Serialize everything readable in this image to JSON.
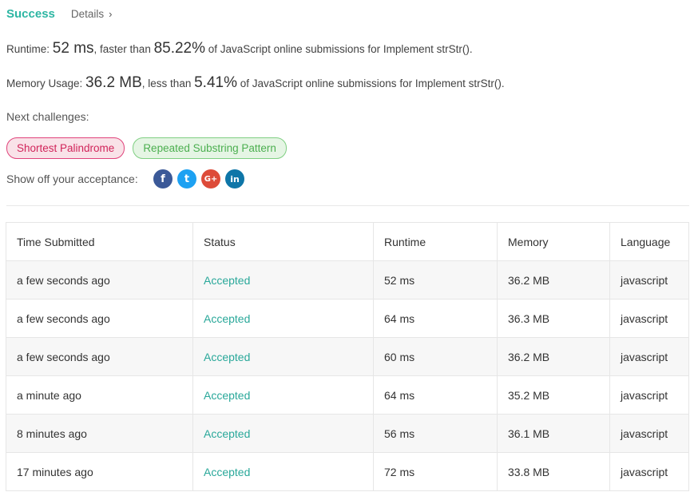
{
  "header": {
    "status": "Success",
    "details_label": "Details",
    "chevron": "›"
  },
  "runtime": {
    "label": "Runtime: ",
    "value": "52 ms",
    "middle": ", faster than ",
    "percent": "85.22%",
    "suffix": " of JavaScript online submissions for Implement strStr()."
  },
  "memory": {
    "label": "Memory Usage: ",
    "value": "36.2 MB",
    "middle": ", less than ",
    "percent": "5.41%",
    "suffix": " of JavaScript online submissions for Implement strStr()."
  },
  "next_challenges": {
    "label": "Next challenges:",
    "items": [
      {
        "label": "Shortest Palindrome",
        "difficulty": "hard",
        "color": "#d1245a"
      },
      {
        "label": "Repeated Substring Pattern",
        "difficulty": "easy",
        "color": "#4caf50"
      }
    ]
  },
  "share": {
    "label": "Show off your acceptance:",
    "icons": [
      {
        "name": "facebook-icon",
        "glyph": "f",
        "color": "#3b5998"
      },
      {
        "name": "twitter-icon",
        "glyph": "t",
        "color": "#1da1f2"
      },
      {
        "name": "google-plus-icon",
        "glyph": "G+",
        "color": "#dd4b39"
      },
      {
        "name": "linkedin-icon",
        "glyph": "in",
        "color": "#0e76a8"
      }
    ]
  },
  "table": {
    "headers": [
      "Time Submitted",
      "Status",
      "Runtime",
      "Memory",
      "Language"
    ],
    "rows": [
      [
        "a few seconds ago",
        "Accepted",
        "52 ms",
        "36.2 MB",
        "javascript"
      ],
      [
        "a few seconds ago",
        "Accepted",
        "64 ms",
        "36.3 MB",
        "javascript"
      ],
      [
        "a few seconds ago",
        "Accepted",
        "60 ms",
        "36.2 MB",
        "javascript"
      ],
      [
        "a minute ago",
        "Accepted",
        "64 ms",
        "35.2 MB",
        "javascript"
      ],
      [
        "8 minutes ago",
        "Accepted",
        "56 ms",
        "36.1 MB",
        "javascript"
      ],
      [
        "17 minutes ago",
        "Accepted",
        "72 ms",
        "33.8 MB",
        "javascript"
      ]
    ]
  },
  "colors": {
    "accent": "#2db6a3",
    "accepted": "#2aa89a"
  }
}
